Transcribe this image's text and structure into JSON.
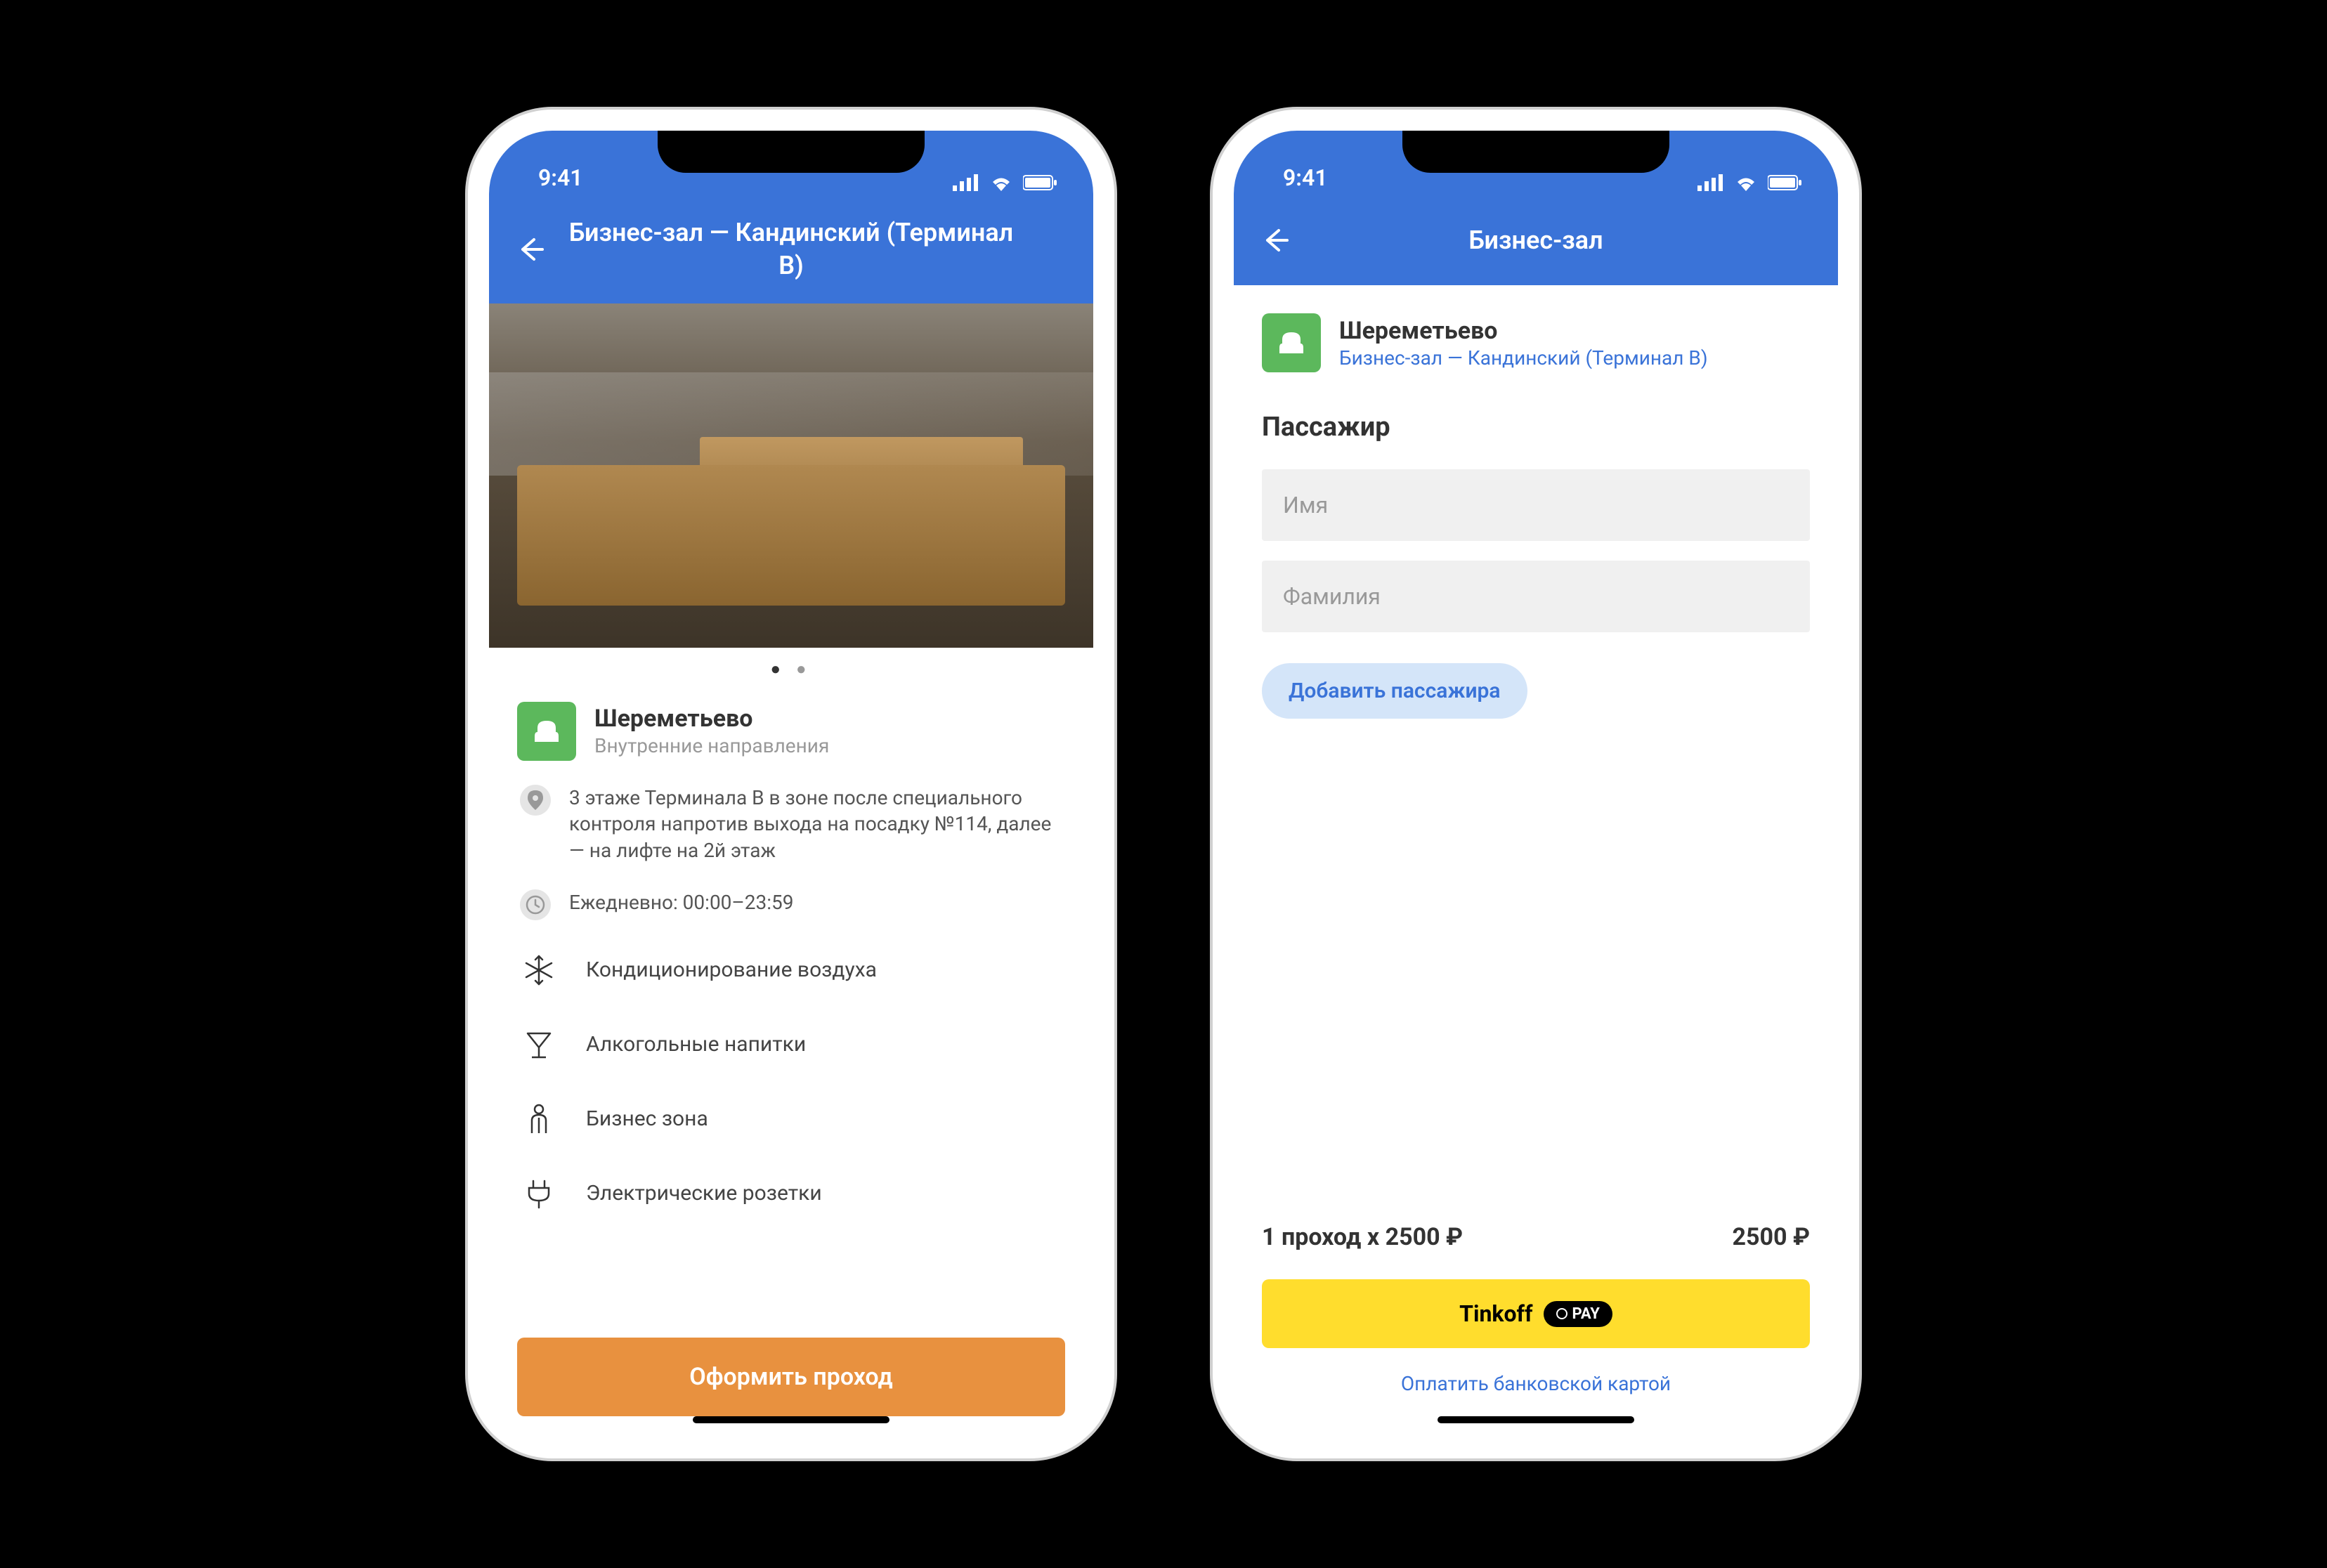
{
  "status": {
    "time": "9:41"
  },
  "phone1": {
    "header": {
      "title": "Бизнес-зал — Кандинский (Терминал B)"
    },
    "lounge": {
      "airport": "Шереметьево",
      "direction": "Внутренние направления",
      "location": "3 этаже Терминала В в зоне после специального контроля напротив выхода на посадку №114, далее — на лифте на 2й этаж",
      "hours": "Ежедневно: 00:00–23:59"
    },
    "amenities": [
      "Кондиционирование воздуха",
      "Алкогольные напитки",
      "Бизнес зона",
      "Электрические розетки"
    ],
    "cta": "Оформить проход"
  },
  "phone2": {
    "header": {
      "title": "Бизнес-зал"
    },
    "lounge": {
      "airport": "Шереметьево",
      "name": "Бизнес-зал — Кандинский (Терминал B)"
    },
    "passenger": {
      "section_title": "Пассажир",
      "first_name_placeholder": "Имя",
      "last_name_placeholder": "Фамилия",
      "add_label": "Добавить пассажира"
    },
    "price": {
      "line": "1 проход x 2500 ₽",
      "total": "2500 ₽"
    },
    "tinkoff_label": "Tinkoff",
    "pay_pill": "PAY",
    "card_link": "Оплатить банковской картой"
  }
}
